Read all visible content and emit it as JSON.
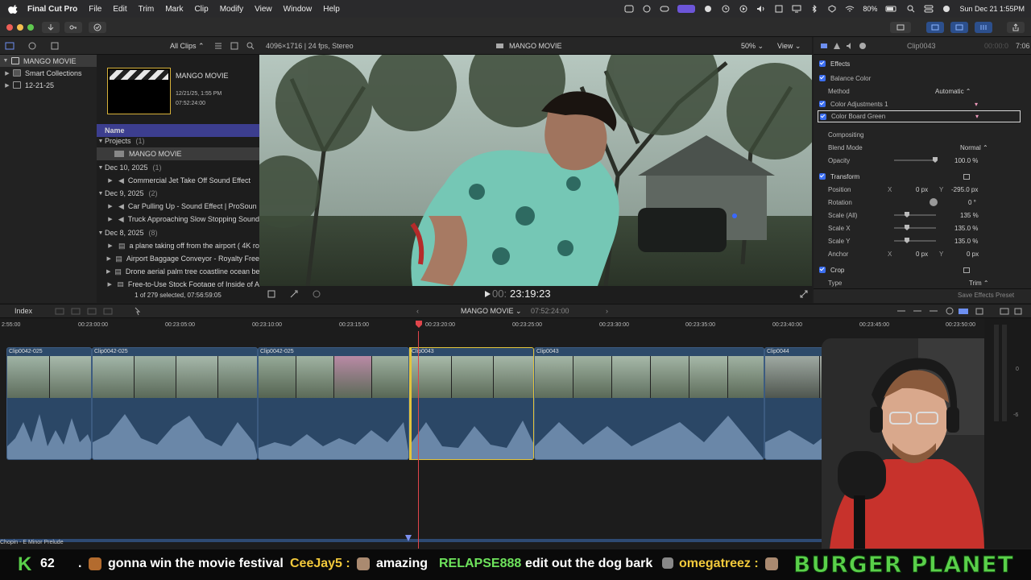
{
  "menubar": {
    "app": "Final Cut Pro",
    "items": [
      "File",
      "Edit",
      "Trim",
      "Mark",
      "Clip",
      "Modify",
      "View",
      "Window",
      "Help"
    ],
    "battery": "80%",
    "datetime": "Sun Dec 21  1:55PM"
  },
  "library": {
    "filter": "All Clips",
    "items": [
      {
        "label": "MANGO MOVIE"
      },
      {
        "label": "Smart Collections"
      },
      {
        "label": "12-21-25"
      }
    ]
  },
  "browser": {
    "project_card": {
      "title": "MANGO MOVIE",
      "date": "12/21/25, 1:55 PM",
      "duration": "07:52:24:00"
    },
    "column_header": "Name",
    "groups": [
      {
        "label": "Projects",
        "count": "(1)",
        "rows": [
          "MANGO MOVIE"
        ]
      },
      {
        "label": "Dec 10, 2025",
        "count": "(1)",
        "rows": [
          "Commercial Jet Take Off Sound Effect"
        ]
      },
      {
        "label": "Dec 9, 2025",
        "count": "(2)",
        "rows": [
          "Car Pulling Up - Sound Effect  |  ProSoun",
          "Truck Approaching Slow Stopping Sound"
        ]
      },
      {
        "label": "Dec 8, 2025",
        "count": "(8)",
        "rows": [
          "a plane taking off from the airport ( 4K ro",
          "Airport Baggage Conveyor - Royalty Free",
          "Drone aerial palm tree coastline ocean be",
          "Free-to-Use Stock Footage of Inside of A"
        ]
      }
    ],
    "footer": "1 of 279 selected, 07:56:59:05"
  },
  "viewer": {
    "format": "4096×1716 | 24 fps, Stereo",
    "title": "MANGO MOVIE",
    "zoom": "50%",
    "view": "View",
    "timecode": "23:19:23",
    "timecode_prefix": "00:"
  },
  "inspector": {
    "clip": "Clip0043",
    "duration": "7:06",
    "duration_prefix": "00:00:0",
    "section_effects": "Effects",
    "balance_color": "Balance Color",
    "method_label": "Method",
    "method_value": "Automatic ⌃",
    "color_adj": "Color Adjustments 1",
    "color_board": "Color Board Green",
    "compositing": "Compositing",
    "blend_label": "Blend Mode",
    "blend_value": "Normal ⌃",
    "opacity_label": "Opacity",
    "opacity_value": "100.0  %",
    "transform": "Transform",
    "position_label": "Position",
    "pos_x_axis": "X",
    "pos_x": "0  px",
    "pos_y_axis": "Y",
    "pos_y": "-295.0  px",
    "rotation_label": "Rotation",
    "rotation_value": "0  °",
    "scale_all_label": "Scale (All)",
    "scale_all_value": "135  %",
    "scale_x_label": "Scale X",
    "scale_x_value": "135.0  %",
    "scale_y_label": "Scale Y",
    "scale_y_value": "135.0  %",
    "anchor_label": "Anchor",
    "anchor_x_axis": "X",
    "anchor_x": "0  px",
    "anchor_y_axis": "Y",
    "anchor_y": "0  px",
    "crop": "Crop",
    "type_label": "Type",
    "type_value": "Trim ⌃",
    "save_preset": "Save Effects Preset"
  },
  "timeline": {
    "index_label": "Index",
    "project": "MANGO MOVIE",
    "duration": "07:52:24:00",
    "ruler": [
      "2:55:00",
      "00:23:00:00",
      "00:23:05:00",
      "00:23:10:00",
      "00:23:15:00",
      "00:23:20:00",
      "00:23:25:00",
      "00:23:30:00",
      "00:23:35:00",
      "00:23:40:00",
      "00:23:45:00",
      "00:23:50:00"
    ],
    "clips": [
      "Clip0042-025",
      "Clip0042-025",
      "Clip0042-025",
      "Clip0043",
      "Clip0043",
      "Clip0044"
    ],
    "music_label": "Chopin - E Minor Prelude",
    "meter_labels": [
      "0",
      "-6"
    ]
  },
  "ticker": {
    "count": "62",
    "msg1": "gonna win the movie festival",
    "user2": "CeeJay5 :",
    "msg2": "amazing",
    "user3": "RELAPSE888 :",
    "msg3": "edit out the dog bark",
    "user4": "omegatreez :",
    "brand": "BURGER PLANET"
  }
}
